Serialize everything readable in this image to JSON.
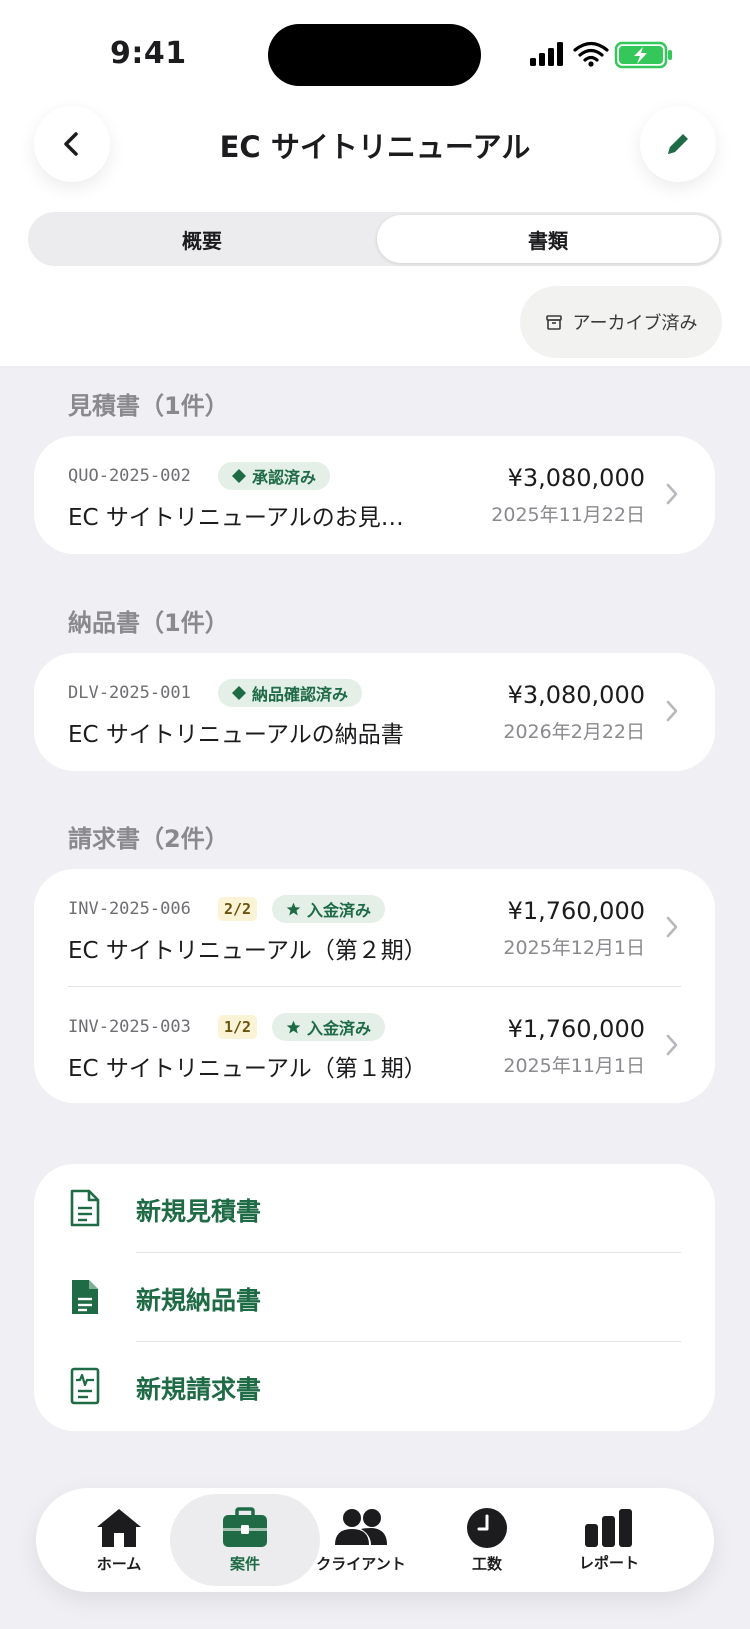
{
  "status_bar": {
    "time": "9:41"
  },
  "nav": {
    "title": "EC サイトリニューアル"
  },
  "segments": [
    {
      "label": "概要"
    },
    {
      "label": "書類"
    }
  ],
  "archive_chip": {
    "label": "アーカイブ済み"
  },
  "sections": {
    "quotes": {
      "label": "見積書（1件）",
      "items": [
        {
          "code": "QUO-2025-002",
          "badge": "承認済み",
          "title": "EC サイトリニューアルのお見…",
          "amount": "¥3,080,000",
          "date": "2025年11月22日"
        }
      ]
    },
    "deliveries": {
      "label": "納品書（1件）",
      "items": [
        {
          "code": "DLV-2025-001",
          "badge": "納品確認済み",
          "title": "EC サイトリニューアルの納品書",
          "amount": "¥3,080,000",
          "date": "2026年2月22日"
        }
      ]
    },
    "invoices": {
      "label": "請求書（2件）",
      "items": [
        {
          "code": "INV-2025-006",
          "part": "2/2",
          "badge": "入金済み",
          "title": "EC サイトリニューアル（第２期）",
          "amount": "¥1,760,000",
          "date": "2025年12月1日"
        },
        {
          "code": "INV-2025-003",
          "part": "1/2",
          "badge": "入金済み",
          "title": "EC サイトリニューアル（第１期）",
          "amount": "¥1,760,000",
          "date": "2025年11月1日"
        }
      ]
    }
  },
  "new_actions": [
    {
      "label": "新規見積書",
      "icon": "document-outline-icon"
    },
    {
      "label": "新規納品書",
      "icon": "document-filled-icon"
    },
    {
      "label": "新規請求書",
      "icon": "invoice-icon"
    }
  ],
  "tabbar": [
    {
      "label": "ホーム",
      "icon": "house-icon"
    },
    {
      "label": "案件",
      "icon": "briefcase-icon",
      "active": true
    },
    {
      "label": "クライアント",
      "icon": "people-icon"
    },
    {
      "label": "工数",
      "icon": "clock-icon"
    },
    {
      "label": "レポート",
      "icon": "bar-chart-icon"
    }
  ],
  "colors": {
    "accent": "#1e6b45",
    "badge_bg": "#e3efe7",
    "part_bg": "#fbf3d5",
    "background": "#efeff4"
  }
}
